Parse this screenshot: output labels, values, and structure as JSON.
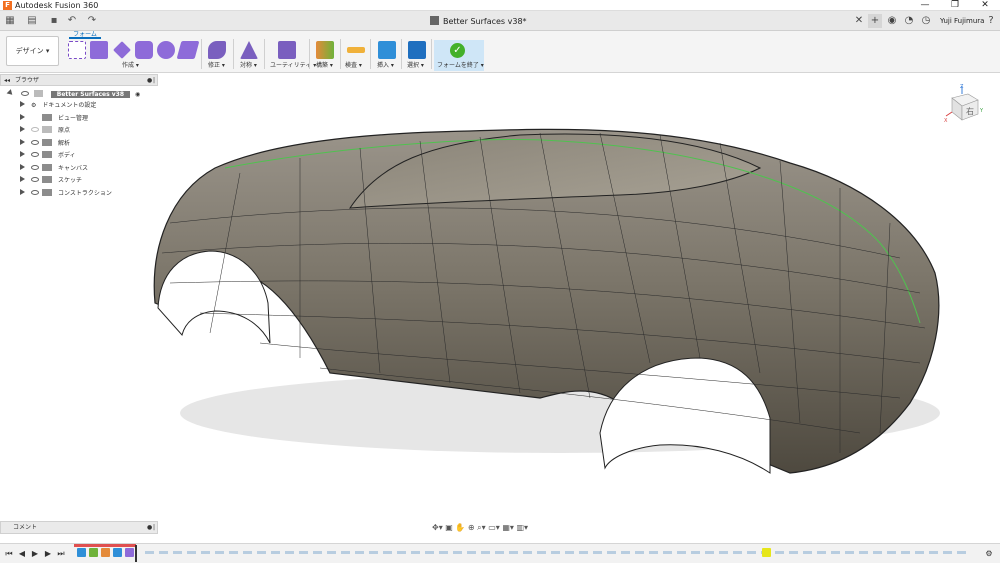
{
  "window": {
    "app_title": "Autodesk Fusion 360",
    "minimize": "—",
    "maximize": "❐",
    "close": "✕"
  },
  "tabbar": {
    "document_tab": "Better Surfaces v38*",
    "close_tab": "✕",
    "user_name": "Yuji Fujimura"
  },
  "toolbar": {
    "workspace": "デザイン ▾",
    "active_tab": "フォーム",
    "groups": [
      {
        "label": "作成 ▾"
      },
      {
        "label": "修正 ▾"
      },
      {
        "label": "対称 ▾"
      },
      {
        "label": "ユーティリティ ▾"
      },
      {
        "label": "構築 ▾"
      },
      {
        "label": "検査 ▾"
      },
      {
        "label": "挿入 ▾"
      },
      {
        "label": "選択 ▾"
      },
      {
        "label": "フォームを終了 ▾"
      }
    ]
  },
  "browser": {
    "title": "ブラウザ",
    "root": "Better Surfaces v38",
    "items": [
      {
        "label": "ドキュメントの設定"
      },
      {
        "label": "ビュー管理"
      },
      {
        "label": "原点"
      },
      {
        "label": "解析"
      },
      {
        "label": "ボディ"
      },
      {
        "label": "キャンバス"
      },
      {
        "label": "スケッチ"
      },
      {
        "label": "コンストラクション"
      }
    ]
  },
  "viewcube": {
    "face_label": "右",
    "axis_x": "X",
    "axis_y": "Y",
    "axis_z": "Z"
  },
  "comments": {
    "title": "コメント"
  },
  "colors": {
    "accent": "#0a6ebd",
    "finish_check": "#43b02a",
    "model_body": "#7a7468",
    "playhead": "#e05050",
    "highlight_edge": "#4fc24f"
  }
}
